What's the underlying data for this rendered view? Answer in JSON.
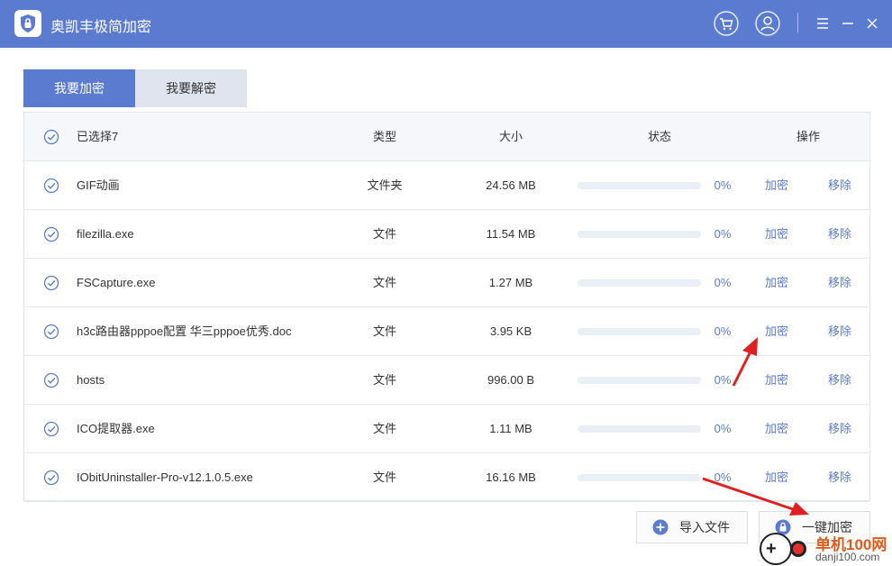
{
  "app": {
    "title": "奥凯丰极简加密"
  },
  "titlebar": {
    "cart_icon": "cart-icon",
    "user_icon": "user-icon",
    "menu_icon": "menu-icon",
    "minimize_icon": "minimize-icon",
    "close_icon": "close-icon"
  },
  "tabs": [
    {
      "label": "我要加密",
      "active": true
    },
    {
      "label": "我要解密",
      "active": false
    }
  ],
  "table": {
    "headers": {
      "selected": "已选择7",
      "type": "类型",
      "size": "大小",
      "status": "状态",
      "action": "操作"
    },
    "rows": [
      {
        "name": "GIF动画",
        "type": "文件夹",
        "size": "24.56 MB",
        "progress": "0%",
        "encrypt": "加密",
        "remove": "移除"
      },
      {
        "name": "filezilla.exe",
        "type": "文件",
        "size": "11.54 MB",
        "progress": "0%",
        "encrypt": "加密",
        "remove": "移除"
      },
      {
        "name": "FSCapture.exe",
        "type": "文件",
        "size": "1.27 MB",
        "progress": "0%",
        "encrypt": "加密",
        "remove": "移除"
      },
      {
        "name": "h3c路由器pppoe配置 华三pppoe优秀.doc",
        "type": "文件",
        "size": "3.95 KB",
        "progress": "0%",
        "encrypt": "加密",
        "remove": "移除"
      },
      {
        "name": "hosts",
        "type": "文件",
        "size": "996.00 B",
        "progress": "0%",
        "encrypt": "加密",
        "remove": "移除"
      },
      {
        "name": "ICO提取器.exe",
        "type": "文件",
        "size": "1.11 MB",
        "progress": "0%",
        "encrypt": "加密",
        "remove": "移除"
      },
      {
        "name": "IObitUninstaller-Pro-v12.1.0.5.exe",
        "type": "文件",
        "size": "16.16 MB",
        "progress": "0%",
        "encrypt": "加密",
        "remove": "移除"
      }
    ]
  },
  "footer": {
    "import_label": "导入文件",
    "encrypt_all_label": "一键加密"
  },
  "watermark": {
    "line1": "单机100网",
    "line2": "danji100.com"
  },
  "colors": {
    "accent": "#5b7bd0",
    "annotation_arrow": "#e02020"
  }
}
